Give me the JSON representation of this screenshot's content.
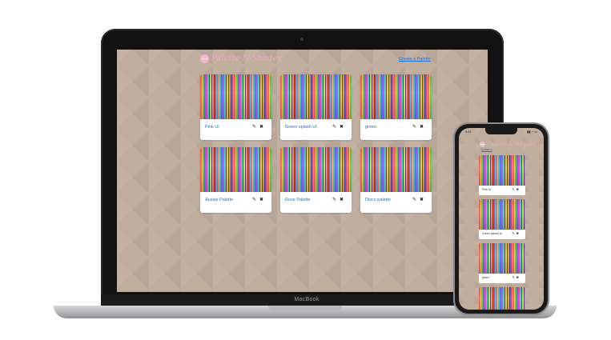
{
  "app": {
    "title": "Palette-N-Shades",
    "create_link": "Create a Palette",
    "device_label": "MacBook"
  },
  "palettes": [
    {
      "name": "Pink UI"
    },
    {
      "name": "Green splash UI"
    },
    {
      "name": "green"
    },
    {
      "name": "Aussie Palette"
    },
    {
      "name": "Rose Palette"
    },
    {
      "name": "Disco palette"
    }
  ],
  "icons": {
    "edit": "✎",
    "delete": "✖"
  },
  "phone": {
    "time": "9:41",
    "status": "▮▮ ◔ ▭",
    "title": "Palette-N-Shades",
    "create_link": "Create a",
    "cards": [
      {
        "name": "Pink UI"
      },
      {
        "name": "Green splash UI"
      },
      {
        "name": "green"
      },
      {
        "name": ""
      }
    ]
  },
  "colors": {
    "background": "#bfad9e",
    "logo": "#f2a9c2",
    "link": "#1f6fd6",
    "card_text": "#2a6fb0"
  }
}
